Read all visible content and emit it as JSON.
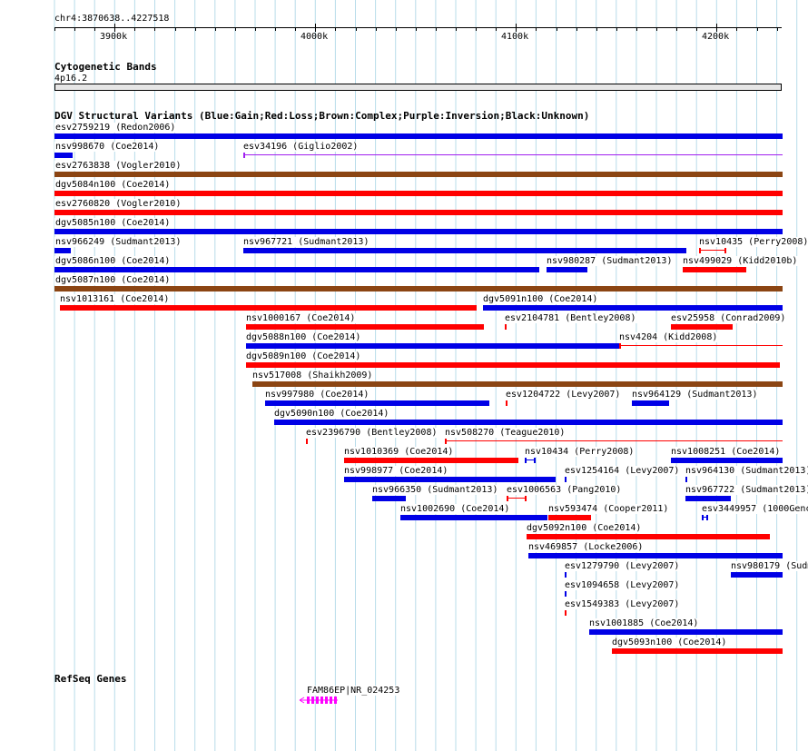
{
  "location": "chr4:3870638..4227518",
  "ruler": {
    "ticks": [
      {
        "label": "3900k",
        "pos": 3900000
      },
      {
        "label": "4000k",
        "pos": 4000000
      },
      {
        "label": "4100k",
        "pos": 4100000
      },
      {
        "label": "4200k",
        "pos": 4200000
      }
    ]
  },
  "cytoband": {
    "title": "Cytogenetic Bands",
    "band": "4p16.2"
  },
  "dgv": {
    "title": "DGV Structural Variants (Blue:Gain;Red:Loss;Brown:Complex;Purple:Inversion;Black:Unknown)",
    "colors": {
      "gain": "#0000e6",
      "loss": "#ff0000",
      "complex": "#8b4513",
      "inversion": "#a020f0",
      "unknown": "#000000"
    },
    "features": [
      {
        "label": "esv2759219 (Redon2006)",
        "type": "gain"
      },
      {
        "label": "nsv998670 (Coe2014)",
        "type": "gain"
      },
      {
        "label": "esv34196 (Giglio2002)",
        "type": "inversion"
      },
      {
        "label": "esv2763838 (Vogler2010)",
        "type": "complex"
      },
      {
        "label": "dgv5084n100 (Coe2014)",
        "type": "loss"
      },
      {
        "label": "esv2760820 (Vogler2010)",
        "type": "loss"
      },
      {
        "label": "dgv5085n100 (Coe2014)",
        "type": "gain"
      },
      {
        "label": "nsv966249 (Sudmant2013)",
        "type": "gain"
      },
      {
        "label": "nsv967721 (Sudmant2013)",
        "type": "gain"
      },
      {
        "label": "nsv10435 (Perry2008)",
        "type": "loss"
      },
      {
        "label": "dgv5086n100 (Coe2014)",
        "type": "gain"
      },
      {
        "label": "nsv980287 (Sudmant2013)",
        "type": "gain"
      },
      {
        "label": "nsv499029 (Kidd2010b)",
        "type": "loss"
      },
      {
        "label": "dgv5087n100 (Coe2014)",
        "type": "complex"
      },
      {
        "label": "nsv1013161 (Coe2014)",
        "type": "loss"
      },
      {
        "label": "dgv5091n100 (Coe2014)",
        "type": "gain"
      },
      {
        "label": "nsv1000167 (Coe2014)",
        "type": "loss"
      },
      {
        "label": "esv2104781 (Bentley2008)",
        "type": "loss"
      },
      {
        "label": "esv25958 (Conrad2009)",
        "type": "loss"
      },
      {
        "label": "dgv5088n100 (Coe2014)",
        "type": "gain"
      },
      {
        "label": "nsv4204 (Kidd2008)",
        "type": "loss"
      },
      {
        "label": "dgv5089n100 (Coe2014)",
        "type": "loss"
      },
      {
        "label": "nsv517008 (Shaikh2009)",
        "type": "complex"
      },
      {
        "label": "nsv997980 (Coe2014)",
        "type": "gain"
      },
      {
        "label": "esv1204722 (Levy2007)",
        "type": "loss"
      },
      {
        "label": "nsv964129 (Sudmant2013)",
        "type": "gain"
      },
      {
        "label": "dgv5090n100 (Coe2014)",
        "type": "gain"
      },
      {
        "label": "esv2396790 (Bentley2008)",
        "type": "loss"
      },
      {
        "label": "nsv508270 (Teague2010)",
        "type": "loss"
      },
      {
        "label": "nsv1010369 (Coe2014)",
        "type": "loss"
      },
      {
        "label": "nsv10434 (Perry2008)",
        "type": "gain"
      },
      {
        "label": "nsv1008251 (Coe2014)",
        "type": "gain"
      },
      {
        "label": "nsv998977 (Coe2014)",
        "type": "gain"
      },
      {
        "label": "esv1254164 (Levy2007)",
        "type": "gain"
      },
      {
        "label": "nsv964130 (Sudmant2013)",
        "type": "gain"
      },
      {
        "label": "nsv966350 (Sudmant2013)",
        "type": "gain"
      },
      {
        "label": "esv1006563 (Pang2010)",
        "type": "loss"
      },
      {
        "label": "nsv967722 (Sudmant2013)",
        "type": "gain"
      },
      {
        "label": "nsv1002690 (Coe2014)",
        "type": "gain"
      },
      {
        "label": "nsv593474 (Cooper2011)",
        "type": "loss"
      },
      {
        "label": "esv3449957 (1000Genc",
        "type": "gain"
      },
      {
        "label": "dgv5092n100 (Coe2014)",
        "type": "loss"
      },
      {
        "label": "nsv469857 (Locke2006)",
        "type": "gain"
      },
      {
        "label": "esv1279790 (Levy2007)",
        "type": "gain"
      },
      {
        "label": "nsv980179 (Sudm",
        "type": "gain"
      },
      {
        "label": "esv1094658 (Levy2007)",
        "type": "gain"
      },
      {
        "label": "esv1549383 (Levy2007)",
        "type": "loss"
      },
      {
        "label": "nsv1001885 (Coe2014)",
        "type": "gain"
      },
      {
        "label": "dgv5093n100 (Coe2014)",
        "type": "loss"
      }
    ]
  },
  "refseq": {
    "title": "RefSeq Genes",
    "genes": [
      {
        "label": "FAM86EP|NR_024253",
        "color": "#ff00ff"
      }
    ]
  }
}
